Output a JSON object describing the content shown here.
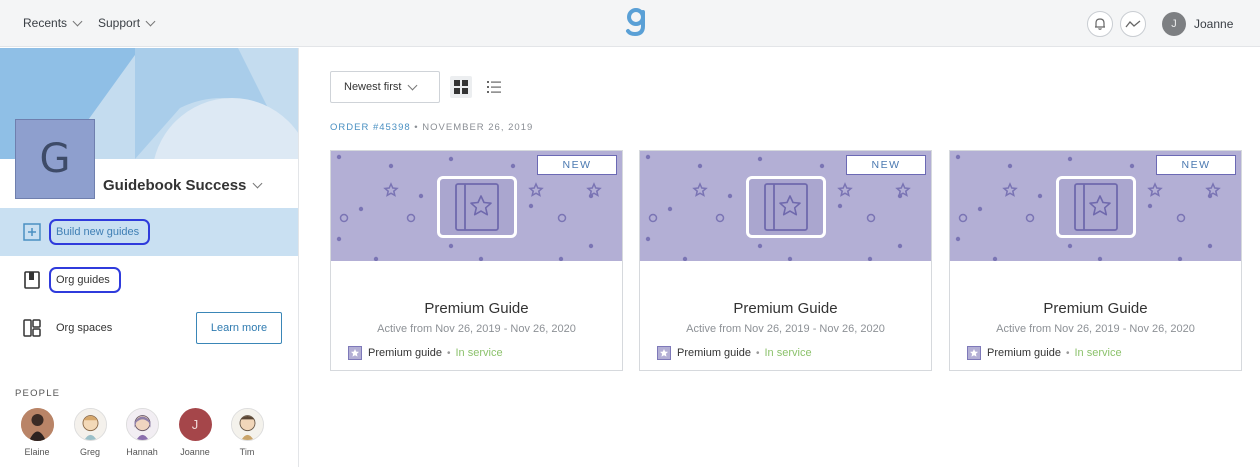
{
  "topbar": {
    "nav": [
      {
        "label": "Recents"
      },
      {
        "label": "Support"
      }
    ],
    "user": {
      "initial": "J",
      "name": "Joanne"
    }
  },
  "sidebar": {
    "org": {
      "initial": "G",
      "name": "Guidebook Success"
    },
    "items": [
      {
        "label": "Build new guides"
      },
      {
        "label": "Org guides"
      },
      {
        "label": "Org spaces"
      }
    ],
    "learn_more": "Learn more",
    "people_heading": "PEOPLE",
    "people": [
      {
        "name": "Elaine"
      },
      {
        "name": "Greg"
      },
      {
        "name": "Hannah"
      },
      {
        "name": "Joanne",
        "initial": "J"
      },
      {
        "name": "Tim"
      }
    ]
  },
  "main": {
    "sort_label": "Newest first",
    "order_number": "ORDER #45398",
    "order_sep": "•",
    "order_date": "NOVEMBER 26, 2019",
    "cards": [
      {
        "badge": "NEW",
        "title": "Premium Guide",
        "active": "Active from Nov 26, 2019 - Nov 26, 2020",
        "type": "Premium guide",
        "status": "In service"
      },
      {
        "badge": "NEW",
        "title": "Premium Guide",
        "active": "Active from Nov 26, 2019 - Nov 26, 2020",
        "type": "Premium guide",
        "status": "In service"
      },
      {
        "badge": "NEW",
        "title": "Premium Guide",
        "active": "Active from Nov 26, 2019 - Nov 26, 2020",
        "type": "Premium guide",
        "status": "In service"
      }
    ]
  },
  "colors": {
    "accent": "#4a90c2",
    "banner": "#c4dcef",
    "card_hero": "#b3afd5",
    "status_green": "#8cc26c",
    "focus_ring": "#2f3bdc"
  }
}
